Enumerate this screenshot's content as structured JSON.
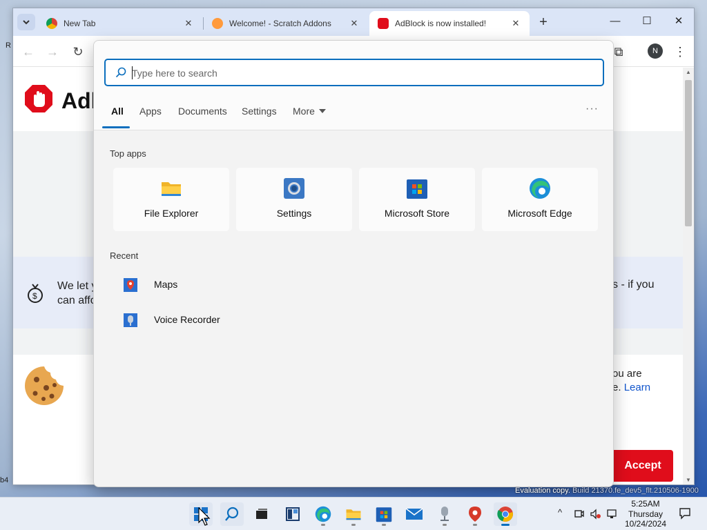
{
  "browser": {
    "tabs": [
      {
        "title": "New Tab",
        "close": "✕",
        "active": false
      },
      {
        "title": "Welcome! - Scratch Addons",
        "close": "✕",
        "active": false
      },
      {
        "title": "AdBlock is now installed!",
        "close": "✕",
        "active": true
      }
    ],
    "new_tab": "+",
    "tab_menu": "⌄",
    "window_controls": {
      "minimize": "—",
      "maximize": "☐",
      "close": "✕"
    },
    "toolbar": {
      "back": "←",
      "forward": "→",
      "reload": "↻",
      "extensions": "⧉",
      "profile_initial": "N",
      "menu": "⋮"
    }
  },
  "page": {
    "title_fragment": "Adl",
    "support_text_left_line1": "We let y",
    "support_text_left_line2": "can affo",
    "support_text_right": "s - if you",
    "cookie_text_line1": "ou are",
    "cookie_text_line2_prefix": "e. ",
    "cookie_learn": "Learn",
    "accept_button": "Accept",
    "accent_red": "#e00d1b"
  },
  "search": {
    "placeholder": "Type here to search",
    "filters": [
      "All",
      "Apps",
      "Documents",
      "Settings",
      "More"
    ],
    "active_filter": "All",
    "more_options": "···",
    "top_apps_label": "Top apps",
    "top_apps": [
      {
        "name": "File Explorer",
        "icon": "file-explorer-icon"
      },
      {
        "name": "Settings",
        "icon": "settings-icon"
      },
      {
        "name": "Microsoft Store",
        "icon": "microsoft-store-icon"
      },
      {
        "name": "Microsoft Edge",
        "icon": "microsoft-edge-icon"
      }
    ],
    "recent_label": "Recent",
    "recent": [
      {
        "name": "Maps",
        "icon": "maps-icon"
      },
      {
        "name": "Voice Recorder",
        "icon": "voice-recorder-icon"
      }
    ],
    "accent": "#0a6ebd"
  },
  "taskbar": {
    "apps": [
      "Start",
      "Search",
      "Task View",
      "Widgets",
      "Microsoft Edge",
      "File Explorer",
      "Microsoft Store",
      "Mail",
      "Voice Recorder",
      "Maps",
      "Google Chrome"
    ],
    "tray": {
      "chevron": "^"
    },
    "clock": {
      "time": "5:25AM",
      "day": "Thursday",
      "date": "10/24/2024"
    }
  },
  "watermark": {
    "text": "Evaluation copy. ",
    "build": "Build 21370.fe_dev5_flt.210506-1900"
  },
  "desktop": {
    "left_text": "R",
    "left_text2": "b4"
  }
}
